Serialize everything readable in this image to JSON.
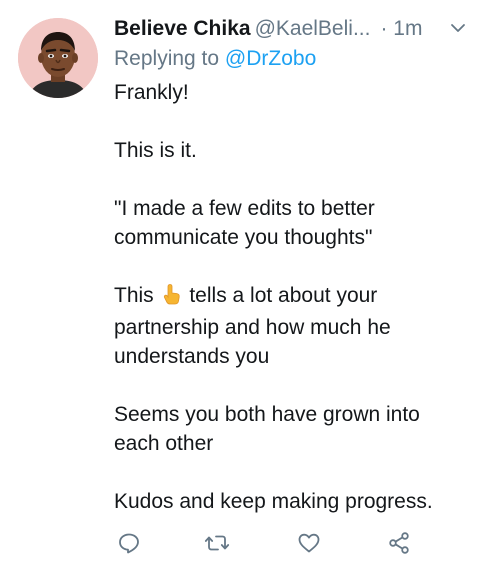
{
  "tweet": {
    "author_name": "Believe Chika",
    "author_handle": "@KaelBeli...",
    "separator": "·",
    "time": "1m",
    "reply_prefix": "Replying to",
    "reply_to": "@DrZobo",
    "paragraphs": [
      "Frankly!",
      "This is it.",
      "\"I made a few edits to better communicate you thoughts\"",
      {
        "before": "This",
        "emoji": "pointing-up-hand-emoji",
        "after": "tells a lot about your partnership and how much he understands you"
      },
      "Seems you both have grown into each other",
      "Kudos and keep making progress."
    ],
    "paragraph_1": "Frankly!",
    "paragraph_2": "This is it.",
    "paragraph_3": "\"I made a few edits to better communicate you thoughts\"",
    "paragraph_4_before": "This",
    "paragraph_4_after": "tells a lot about your partnership and how much he understands you",
    "paragraph_5": "Seems you both have grown into each other",
    "paragraph_6": "Kudos and keep making progress."
  },
  "icons": {
    "avatar": "avatar-cartoon-man",
    "caret": "chevron-down-icon",
    "reply": "reply-icon",
    "retweet": "retweet-icon",
    "like": "heart-icon",
    "share": "share-icon"
  },
  "colors": {
    "accent": "#1da1f2",
    "secondary_text": "#657786",
    "primary_text": "#14171a",
    "avatar_bg": "#f2c7c4",
    "icon": "#657786"
  }
}
